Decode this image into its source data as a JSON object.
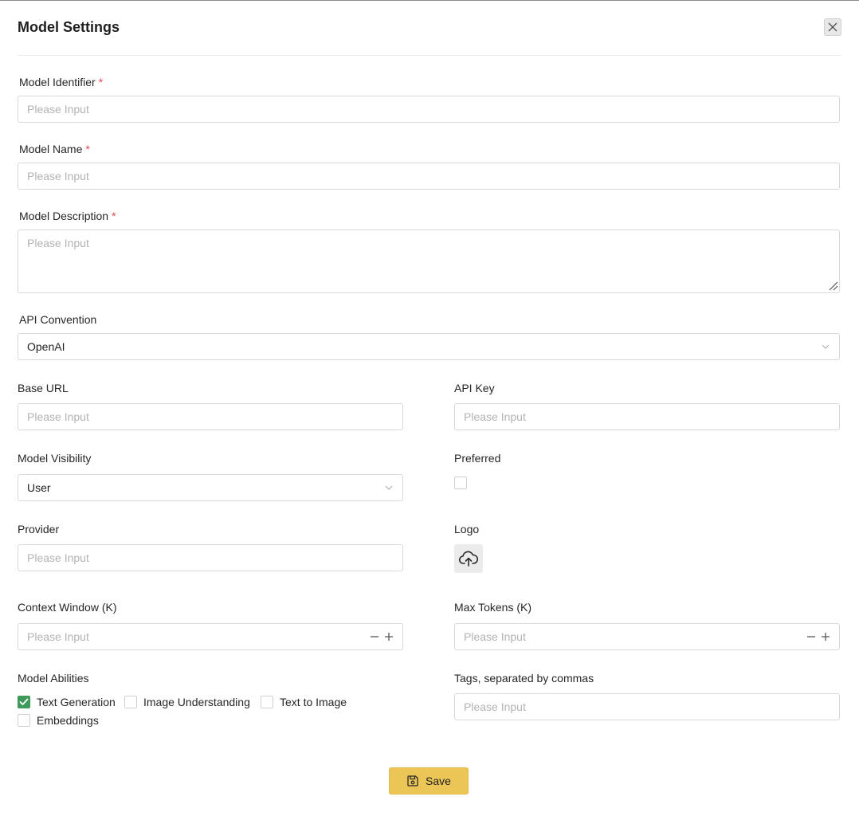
{
  "dialog": {
    "title": "Model Settings"
  },
  "fields": {
    "model_identifier": {
      "label": "Model Identifier",
      "required_mark": "*",
      "placeholder": "Please Input",
      "value": ""
    },
    "model_name": {
      "label": "Model Name",
      "required_mark": "*",
      "placeholder": "Please Input",
      "value": ""
    },
    "model_description": {
      "label": "Model Description",
      "required_mark": "*",
      "placeholder": "Please Input",
      "value": ""
    },
    "api_convention": {
      "label": "API Convention",
      "value": "OpenAI"
    },
    "base_url": {
      "label": "Base URL",
      "placeholder": "Please Input",
      "value": ""
    },
    "api_key": {
      "label": "API Key",
      "placeholder": "Please Input",
      "value": ""
    },
    "model_visibility": {
      "label": "Model Visibility",
      "value": "User"
    },
    "preferred": {
      "label": "Preferred",
      "checked": false
    },
    "provider": {
      "label": "Provider",
      "placeholder": "Please Input",
      "value": ""
    },
    "logo": {
      "label": "Logo",
      "icon": "cloud-upload-icon"
    },
    "context_window": {
      "label": "Context Window (K)",
      "placeholder": "Please Input",
      "value": ""
    },
    "max_tokens": {
      "label": "Max Tokens (K)",
      "placeholder": "Please Input",
      "value": ""
    },
    "tags": {
      "label": "Tags, separated by commas",
      "placeholder": "Please Input",
      "value": ""
    }
  },
  "abilities": {
    "label": "Model Abilities",
    "items": [
      {
        "label": "Text Generation",
        "checked": true
      },
      {
        "label": "Image Understanding",
        "checked": false
      },
      {
        "label": "Text to Image",
        "checked": false
      },
      {
        "label": "Embeddings",
        "checked": false
      }
    ]
  },
  "actions": {
    "save_label": "Save"
  },
  "colors": {
    "accent": "#ebc556",
    "checkbox_checked": "#3e9a5a",
    "required": "#e5484d"
  }
}
